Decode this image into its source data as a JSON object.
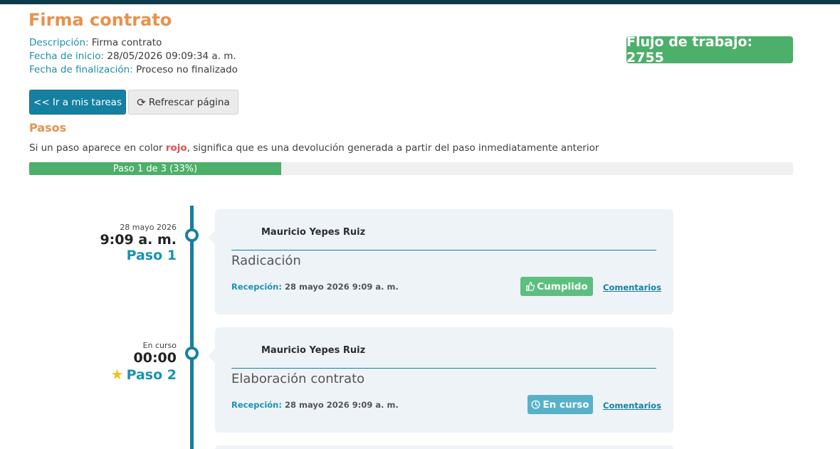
{
  "header": {
    "title": "Firma contrato",
    "meta": [
      {
        "label": "Descripción:",
        "value": "Firma contrato"
      },
      {
        "label": "Fecha de inicio:",
        "value": "28/05/2026 09:09:34 a. m."
      },
      {
        "label": "Fecha de finalización:",
        "value": "Proceso no finalizado"
      }
    ],
    "workflow_badge": "Flujo de trabajo: 2755"
  },
  "toolbar": {
    "tasks_button": "<< Ir a mis tareas",
    "refresh_button": "Refrescar página"
  },
  "steps": {
    "heading": "Pasos",
    "note_prefix": "Si un paso aparece en color ",
    "note_red": "rojo",
    "note_suffix": ", significa que es una devolución generada a partir del paso inmediatamente anterior",
    "progress_label": "Paso 1 de 3 (33%)",
    "progress_fraction": 0.33
  },
  "timeline": [
    {
      "date_small": "28 mayo 2026",
      "time": "9:09 a. m.",
      "step_label": "Paso 1",
      "starred": false,
      "person": "Mauricio Yepes Ruiz",
      "task": "Radicación",
      "reception_label": "Recepción:",
      "reception_value": "28 mayo 2026 9:09 a. m.",
      "status": "Cumplido",
      "status_icon": "thumbs-up-icon",
      "status_color": "#5cbf7f",
      "comments": "Comentarios"
    },
    {
      "date_small": "En curso",
      "time": "00:00",
      "step_label": "Paso 2",
      "starred": true,
      "person": "Mauricio Yepes Ruiz",
      "task": "Elaboración contrato",
      "reception_label": "Recepción:",
      "reception_value": "28 mayo 2026 9:09 a. m.",
      "status": "En curso",
      "status_icon": "clock-icon",
      "status_color": "#58b1c8",
      "comments": "Comentarios"
    }
  ],
  "colors": {
    "accent": "#1580a0",
    "title": "#e8914d",
    "success": "#4caf6a"
  }
}
